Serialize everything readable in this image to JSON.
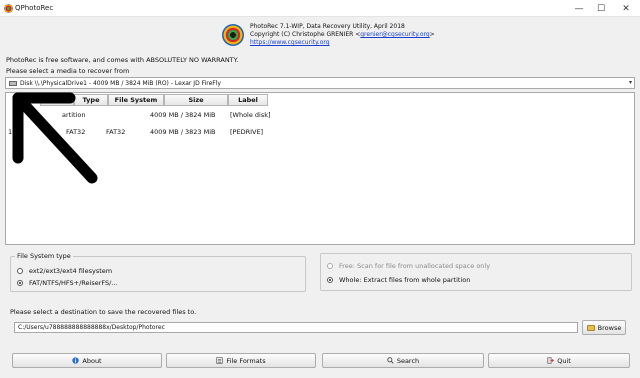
{
  "window": {
    "title": "QPhotoRec",
    "min_glyph": "—",
    "max_glyph": "☐",
    "close_glyph": "✕"
  },
  "header": {
    "line1": "PhotoRec 7.1-WIP, Data Recovery Utility, April 2018",
    "line2_prefix": "Copyright (C) Christophe GRENIER <",
    "email": "grenier@cgsecurity.org",
    "line2_suffix": ">",
    "website": "https://www.cgsecurity.org"
  },
  "notice": "PhotoRec is free software, and comes with ABSOLUTELY NO WARRANTY.",
  "media_prompt": "Please select a media to recover from",
  "disk_select": {
    "value": "Disk \\\\.\\PhysicalDrive1 - 4009 MB / 3824 MiB (RO) - Lexar JD FireFly",
    "arrow": "▾"
  },
  "partition_table": {
    "columns": [
      "Type",
      "File System",
      "Size",
      "Label"
    ],
    "columns_partial": "os",
    "rows": [
      {
        "num": "",
        "type": "",
        "fs": "artition",
        "size": "4009 MB / 3824 MiB",
        "label": "[Whole disk]"
      },
      {
        "num": "1",
        "type": "FAT32",
        "fs": "FAT32",
        "size": "4009 MB / 3823 MiB",
        "label": "[PEDRIVE]"
      }
    ]
  },
  "fs_type": {
    "legend": "File System type",
    "options": [
      {
        "label": "ext2/ext3/ext4 filesystem",
        "checked": false
      },
      {
        "label": "FAT/NTFS/HFS+/ReiserFS/...",
        "checked": true
      }
    ]
  },
  "scan_scope": {
    "options": [
      {
        "label": "Free: Scan for file from unallocated space only",
        "checked": false,
        "disabled": true
      },
      {
        "label": "Whole: Extract files from whole partition",
        "checked": true,
        "disabled": false
      }
    ]
  },
  "destination": {
    "label": "Please select a destination to save the recovered files to.",
    "path": "C:/Users/u788888888888888x/Desktop/Photorec",
    "browse_label": "Browse"
  },
  "buttons": {
    "about": "About",
    "file_formats": "File Formats",
    "search": "Search",
    "quit": "Quit"
  },
  "colors": {
    "link": "#1a3fd0",
    "window_bg": "#f0f0f0"
  }
}
